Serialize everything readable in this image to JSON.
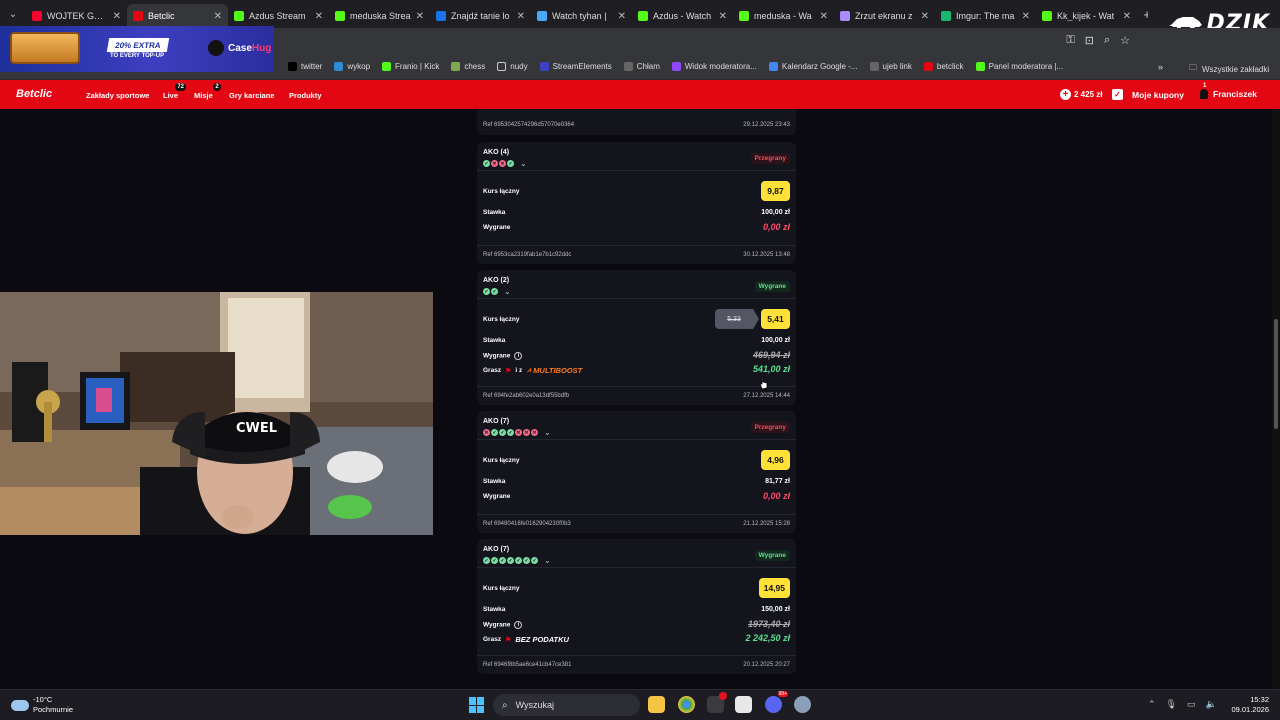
{
  "browser": {
    "tabs": [
      {
        "title": "WOJTEK GOLA",
        "icon": "youtube-icon",
        "color": "#ff0033"
      },
      {
        "title": "Betclic",
        "icon": "betclic-icon",
        "color": "#e30613",
        "active": true
      },
      {
        "title": "Azdus Stream",
        "icon": "kick-icon",
        "color": "#53fc18"
      },
      {
        "title": "meduska Strea",
        "icon": "kick-icon",
        "color": "#53fc18"
      },
      {
        "title": "Znajdź tanie lo",
        "icon": "flights-icon",
        "color": "#1a73e8"
      },
      {
        "title": "Watch tyhan |",
        "icon": "watch-icon",
        "color": "#4aa8ff"
      },
      {
        "title": "Azdus - Watch",
        "icon": "kick-icon",
        "color": "#53fc18"
      },
      {
        "title": "meduska - Wa",
        "icon": "kick-icon",
        "color": "#53fc18"
      },
      {
        "title": "Zrzut ekranu z",
        "icon": "pen-icon",
        "color": "#a98dff"
      },
      {
        "title": "Imgur: The ma",
        "icon": "imgur-icon",
        "color": "#1bb76e"
      },
      {
        "title": "Kk_kijek - Wat",
        "icon": "kick-icon",
        "color": "#53fc18"
      }
    ],
    "bookmarks": [
      {
        "label": "twitter",
        "icon": "x-icon"
      },
      {
        "label": "wykop",
        "icon": "wykop-icon"
      },
      {
        "label": "Franio | Kick",
        "icon": "kick-icon"
      },
      {
        "label": "chess",
        "icon": "pawn-icon"
      },
      {
        "label": "nudy",
        "icon": "folder-icon"
      },
      {
        "label": "StreamElements",
        "icon": "streamelements-icon"
      },
      {
        "label": "Chłam",
        "icon": "globe-icon"
      },
      {
        "label": "Widok moderatora...",
        "icon": "twitch-icon"
      },
      {
        "label": "Kalendarz Google -...",
        "icon": "calendar-icon"
      },
      {
        "label": "ujeb link",
        "icon": "link-icon"
      },
      {
        "label": "betclick",
        "icon": "betclic-icon"
      },
      {
        "label": "Panel moderatora |...",
        "icon": "kick-icon"
      }
    ],
    "all_bookmarks": "Wszystkie zakładki"
  },
  "overlay": {
    "brand": "DZIK",
    "ad_extra": "20% EXTRA",
    "ad_topup": "TO EVERY TOP-UP",
    "ad_logo_a": "Case",
    "ad_logo_b": "Hug"
  },
  "site": {
    "brand": "Betclic",
    "nav": [
      {
        "label": "Zakłady sportowe",
        "badge": ""
      },
      {
        "label": "Live",
        "badge": "72"
      },
      {
        "label": "Misje",
        "badge": "2"
      },
      {
        "label": "Gry karciane",
        "badge": ""
      },
      {
        "label": "Produkty",
        "badge": ""
      }
    ],
    "balance": "2 425 zł",
    "coupons": "Moje kupony",
    "user": "Franciszek",
    "user_badge": "1"
  },
  "labels": {
    "kurs": "Kurs łączny",
    "stawka": "Stawka",
    "wygrane": "Wygrane",
    "grasz": "Grasz",
    "grasz_mid": "i z",
    "multiboost": "MULTIBOOST",
    "bez_podatku": "BEZ PODATKU",
    "przegrany": "Przegrany",
    "wygrany": "Wygrane"
  },
  "bets": [
    {
      "ref": "Ref 6953042574296d57070e0364",
      "date": "29.12.2025 23:43"
    },
    {
      "title": "AKO (4)",
      "status": "Przegrany",
      "picks": [
        "w",
        "l",
        "l",
        "w"
      ],
      "odds": "9,87",
      "stake": "100,00 zł",
      "win": "0,00 zł",
      "ref": "Ref 6953ca2319fab1e7b1c92ddc",
      "date": "30.12.2025 13:48"
    },
    {
      "title": "AKO (2)",
      "status": "Wygrane",
      "picks": [
        "w",
        "w"
      ],
      "old_odds": "5,33",
      "odds": "5,41",
      "stake": "100,00 zł",
      "win_old": "469,94 zł",
      "win": "541,00 zł",
      "ref": "Ref 694fe2ab602e0a13df55bdfb",
      "date": "27.12.2025 14:44"
    },
    {
      "title": "AKO (7)",
      "status": "Przegrany",
      "picks": [
        "l",
        "w",
        "w",
        "w",
        "l",
        "l",
        "l"
      ],
      "odds": "4,96",
      "stake": "81,77 zł",
      "win": "0,00 zł",
      "ref": "Ref 69480416fe0162904230f0b3",
      "date": "21.12.2025 15:28"
    },
    {
      "title": "AKO (7)",
      "status": "Wygrane",
      "picks": [
        "w",
        "w",
        "w",
        "w",
        "w",
        "w",
        "w"
      ],
      "odds": "14,95",
      "stake": "150,00 zł",
      "win_old": "1973,40 zł",
      "win": "2 242,50 zł",
      "ref": "Ref 6946f8b5ae6ce41cb47ce381",
      "date": "20.12.2025 20:27"
    }
  ],
  "webcam": {
    "cap_text": "CWEL"
  },
  "taskbar": {
    "temp": "-10°C",
    "weather": "Pochmurnie",
    "search": "Wyszukaj",
    "time": "15:32",
    "date": "09.01.2026",
    "notif_badge": "99+"
  }
}
